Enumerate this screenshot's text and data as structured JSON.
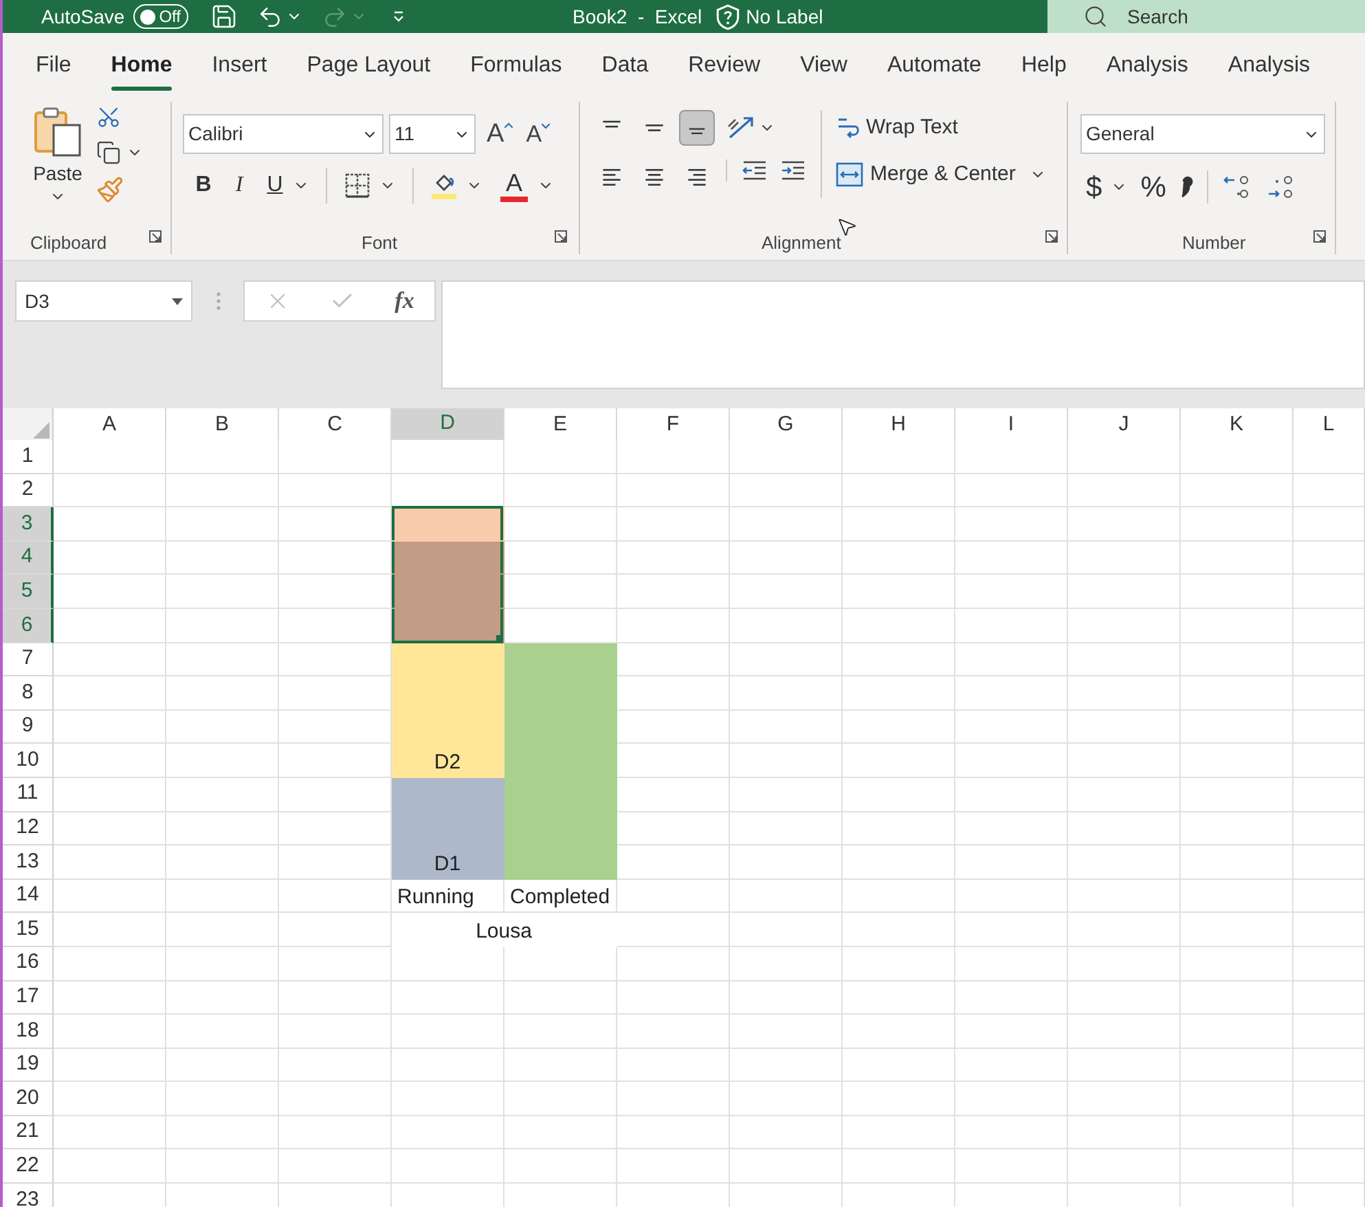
{
  "title_bar": {
    "autosave_label": "AutoSave",
    "autosave_toggle": {
      "label": "Off",
      "on": false
    },
    "document_title": "Book2  -  Excel",
    "sensitivity_label": "No Label",
    "search": {
      "placeholder": "Search"
    }
  },
  "ribbon_tabs": [
    {
      "label": "File",
      "selected": false
    },
    {
      "label": "Home",
      "selected": true
    },
    {
      "label": "Insert",
      "selected": false
    },
    {
      "label": "Page Layout",
      "selected": false
    },
    {
      "label": "Formulas",
      "selected": false
    },
    {
      "label": "Data",
      "selected": false
    },
    {
      "label": "Review",
      "selected": false
    },
    {
      "label": "View",
      "selected": false
    },
    {
      "label": "Automate",
      "selected": false
    },
    {
      "label": "Help",
      "selected": false
    },
    {
      "label": "Analysis",
      "selected": false
    },
    {
      "label": "Analysis",
      "selected": false
    }
  ],
  "ribbon": {
    "clipboard": {
      "title": "Clipboard",
      "paste_label": "Paste"
    },
    "font": {
      "title": "Font",
      "font_name": "Calibri",
      "font_size": "11",
      "grow_font": "A",
      "shrink_font": "A",
      "bold": "B",
      "italic": "I",
      "underline": "U",
      "font_color": "A"
    },
    "alignment": {
      "title": "Alignment",
      "wrap_text": "Wrap Text",
      "merge_center": "Merge & Center"
    },
    "number": {
      "title": "Number",
      "format": "General",
      "currency": "$",
      "percent": "%"
    }
  },
  "formula_bar": {
    "name_box": "D3",
    "function_label": "fx"
  },
  "sheet": {
    "columns": [
      {
        "label": "A",
        "selected": false
      },
      {
        "label": "B",
        "selected": false
      },
      {
        "label": "C",
        "selected": false
      },
      {
        "label": "D",
        "selected": true
      },
      {
        "label": "E",
        "selected": false
      },
      {
        "label": "F",
        "selected": false
      },
      {
        "label": "G",
        "selected": false
      },
      {
        "label": "H",
        "selected": false
      },
      {
        "label": "I",
        "selected": false
      },
      {
        "label": "J",
        "selected": false
      },
      {
        "label": "K",
        "selected": false
      },
      {
        "label": "L",
        "selected": false
      }
    ],
    "rows": [
      {
        "header": "1",
        "selected": false
      },
      {
        "header": "2",
        "selected": false
      },
      {
        "header": "3",
        "selected": true,
        "cells": [
          {},
          {},
          {},
          {
            "color": "#f8cbad",
            "selected": true
          }
        ]
      },
      {
        "header": "4",
        "selected": true,
        "cells": [
          {},
          {},
          {},
          {
            "color": "#c29c84",
            "selected": true
          }
        ]
      },
      {
        "header": "5",
        "selected": true,
        "cells": [
          {},
          {},
          {},
          {
            "color": "#c29c84",
            "selected": true
          }
        ]
      },
      {
        "header": "6",
        "selected": true,
        "cells": [
          {},
          {},
          {},
          {
            "color": "#c29c84",
            "selected": true
          }
        ]
      },
      {
        "header": "7",
        "selected": false,
        "cells": [
          {},
          {},
          {},
          {
            "color": "#ffe699"
          },
          {
            "color": "#a9d08e"
          }
        ]
      },
      {
        "header": "8",
        "selected": false,
        "cells": [
          {},
          {},
          {},
          {
            "color": "#ffe699"
          },
          {
            "color": "#a9d08e"
          }
        ]
      },
      {
        "header": "9",
        "selected": false,
        "cells": [
          {},
          {},
          {},
          {
            "color": "#ffe699"
          },
          {
            "color": "#a9d08e"
          }
        ]
      },
      {
        "header": "10",
        "selected": false,
        "cells": [
          {},
          {},
          {},
          {
            "color": "#ffe699",
            "text": "D2",
            "centered": true
          },
          {
            "color": "#a9d08e"
          }
        ]
      },
      {
        "header": "11",
        "selected": false,
        "cells": [
          {},
          {},
          {},
          {
            "color": "#adb9ca"
          },
          {
            "color": "#a9d08e"
          }
        ]
      },
      {
        "header": "12",
        "selected": false,
        "cells": [
          {},
          {},
          {},
          {
            "color": "#adb9ca"
          },
          {
            "color": "#a9d08e"
          }
        ]
      },
      {
        "header": "13",
        "selected": false,
        "cells": [
          {},
          {},
          {},
          {
            "color": "#adb9ca",
            "text": "D1",
            "centered": true
          },
          {
            "color": "#a9d08e"
          }
        ]
      },
      {
        "header": "14",
        "selected": false,
        "cells": [
          {},
          {},
          {},
          {
            "text": "Running",
            "centered": false
          },
          {
            "text": "Completed",
            "centered": false
          }
        ]
      },
      {
        "header": "15",
        "selected": false,
        "cells": [
          {},
          {},
          {},
          {
            "kind": "merged",
            "text": "Lousa",
            "centered": true
          }
        ]
      },
      {
        "header": "16",
        "selected": false
      },
      {
        "header": "17",
        "selected": false
      },
      {
        "header": "18",
        "selected": false
      },
      {
        "header": "19",
        "selected": false
      },
      {
        "header": "20",
        "selected": false
      },
      {
        "header": "21",
        "selected": false
      },
      {
        "header": "22",
        "selected": false
      },
      {
        "header": "23",
        "selected": false
      }
    ]
  }
}
